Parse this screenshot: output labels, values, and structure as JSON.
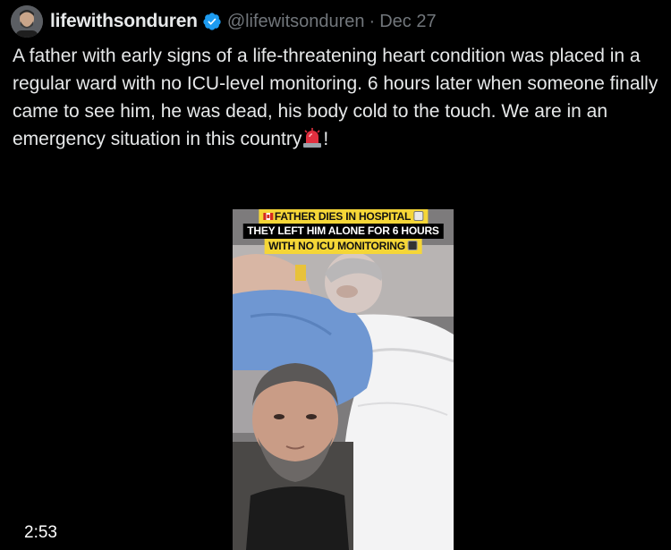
{
  "post": {
    "display_name": "lifewithsonduren",
    "handle": "@lifewitsonduren",
    "separator": "·",
    "date": "Dec 27",
    "text": "A father with early signs of a life-threatening heart condition was placed in a regular ward with no ICU-level monitoring. 6 hours later when someone finally came to see him, he was dead, his body cold to the touch. We are in an emergency situation in this country",
    "text_suffix": "!",
    "verified_icon": "verified-badge-icon",
    "siren_icon": "siren-emoji"
  },
  "video": {
    "caption_line1": "FATHER DIES IN HOSPITAL",
    "caption_line2": "THEY LEFT HIM ALONE FOR 6 HOURS",
    "caption_line3": "WITH NO ICU MONITORING",
    "duration": "2:53"
  },
  "colors": {
    "background": "#000000",
    "text": "#e7e9ea",
    "muted": "#71767b",
    "verified": "#1d9bf0",
    "caption_yellow": "#f5d637"
  }
}
